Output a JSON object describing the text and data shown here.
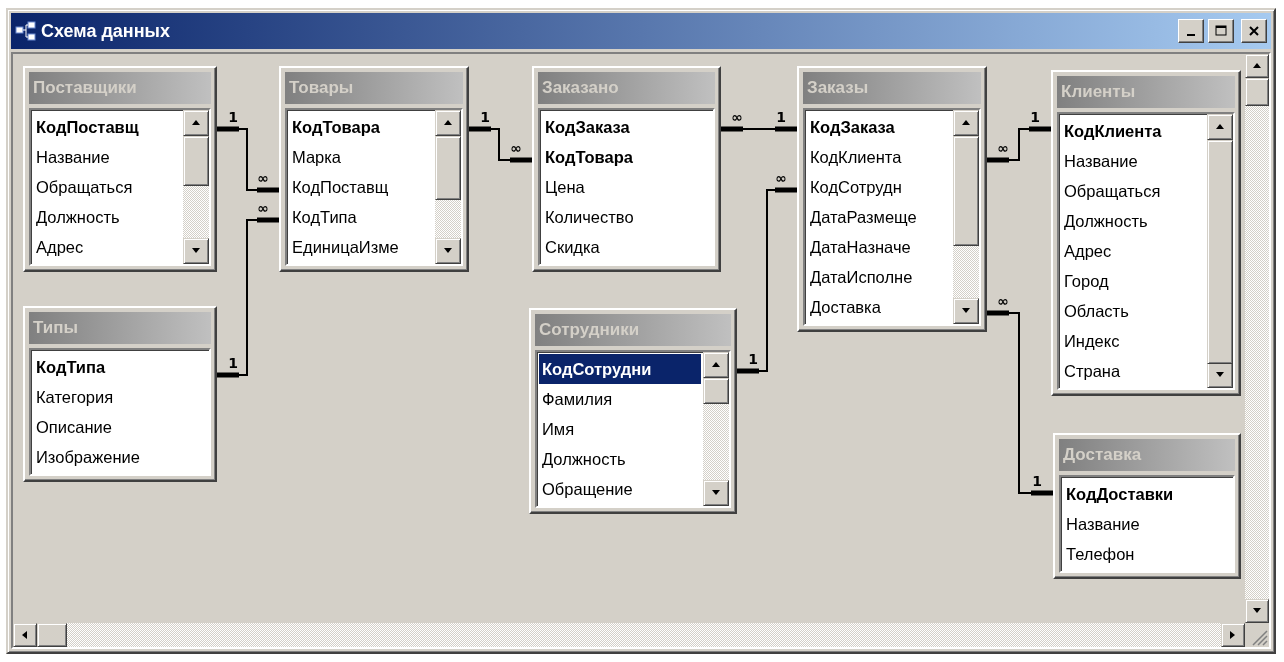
{
  "window": {
    "title": "Схема данных"
  },
  "tables": [
    {
      "title": "Поставщики",
      "scrollable": true,
      "fields": [
        {
          "name": "КодПоставщ",
          "key": true,
          "selected": false
        },
        {
          "name": "Название",
          "key": false,
          "selected": false
        },
        {
          "name": "Обращаться",
          "key": false,
          "selected": false
        },
        {
          "name": "Должность",
          "key": false,
          "selected": false
        },
        {
          "name": "Адрес",
          "key": false,
          "selected": false
        }
      ]
    },
    {
      "title": "Товары",
      "scrollable": true,
      "fields": [
        {
          "name": "КодТовара",
          "key": true,
          "selected": false
        },
        {
          "name": "Марка",
          "key": false,
          "selected": false
        },
        {
          "name": "КодПоставщ",
          "key": false,
          "selected": false
        },
        {
          "name": "КодТипа",
          "key": false,
          "selected": false
        },
        {
          "name": "ЕдиницаИзме",
          "key": false,
          "selected": false
        }
      ]
    },
    {
      "title": "Заказано",
      "scrollable": false,
      "fields": [
        {
          "name": "КодЗаказа",
          "key": true,
          "selected": false
        },
        {
          "name": "КодТовара",
          "key": true,
          "selected": false
        },
        {
          "name": "Цена",
          "key": false,
          "selected": false
        },
        {
          "name": "Количество",
          "key": false,
          "selected": false
        },
        {
          "name": "Скидка",
          "key": false,
          "selected": false
        }
      ]
    },
    {
      "title": "Заказы",
      "scrollable": true,
      "fields": [
        {
          "name": "КодЗаказа",
          "key": true,
          "selected": false
        },
        {
          "name": "КодКлиента",
          "key": false,
          "selected": false
        },
        {
          "name": "КодСотрудн",
          "key": false,
          "selected": false
        },
        {
          "name": "ДатаРазмеще",
          "key": false,
          "selected": false
        },
        {
          "name": "ДатаНазначе",
          "key": false,
          "selected": false
        },
        {
          "name": "ДатаИсполне",
          "key": false,
          "selected": false
        },
        {
          "name": "Доставка",
          "key": false,
          "selected": false
        }
      ]
    },
    {
      "title": "Клиенты",
      "scrollable": true,
      "fields": [
        {
          "name": "КодКлиента",
          "key": true,
          "selected": false
        },
        {
          "name": "Название",
          "key": false,
          "selected": false
        },
        {
          "name": "Обращаться",
          "key": false,
          "selected": false
        },
        {
          "name": "Должность",
          "key": false,
          "selected": false
        },
        {
          "name": "Адрес",
          "key": false,
          "selected": false
        },
        {
          "name": "Город",
          "key": false,
          "selected": false
        },
        {
          "name": "Область",
          "key": false,
          "selected": false
        },
        {
          "name": "Индекс",
          "key": false,
          "selected": false
        },
        {
          "name": "Страна",
          "key": false,
          "selected": false
        }
      ]
    },
    {
      "title": "Типы",
      "scrollable": false,
      "fields": [
        {
          "name": "КодТипа",
          "key": true,
          "selected": false
        },
        {
          "name": "Категория",
          "key": false,
          "selected": false
        },
        {
          "name": "Описание",
          "key": false,
          "selected": false
        },
        {
          "name": "Изображение",
          "key": false,
          "selected": false
        }
      ]
    },
    {
      "title": "Сотрудники",
      "scrollable": true,
      "fields": [
        {
          "name": "КодСотрудни",
          "key": true,
          "selected": true
        },
        {
          "name": "Фамилия",
          "key": false,
          "selected": false
        },
        {
          "name": "Имя",
          "key": false,
          "selected": false
        },
        {
          "name": "Должность",
          "key": false,
          "selected": false
        },
        {
          "name": "Обращение",
          "key": false,
          "selected": false
        }
      ]
    },
    {
      "title": "Доставка",
      "scrollable": false,
      "fields": [
        {
          "name": "КодДоставки",
          "key": true,
          "selected": false
        },
        {
          "name": "Название",
          "key": false,
          "selected": false
        },
        {
          "name": "Телефон",
          "key": false,
          "selected": false
        }
      ]
    }
  ],
  "relationships": [
    {
      "start_label": "1",
      "end_label": "∞"
    },
    {
      "start_label": "1",
      "end_label": "∞"
    },
    {
      "start_label": "1",
      "end_label": "∞"
    },
    {
      "start_label": "∞",
      "end_label": "1"
    },
    {
      "start_label": "1",
      "end_label": "∞"
    },
    {
      "start_label": "∞",
      "end_label": "1"
    },
    {
      "start_label": "∞",
      "end_label": "1"
    }
  ]
}
